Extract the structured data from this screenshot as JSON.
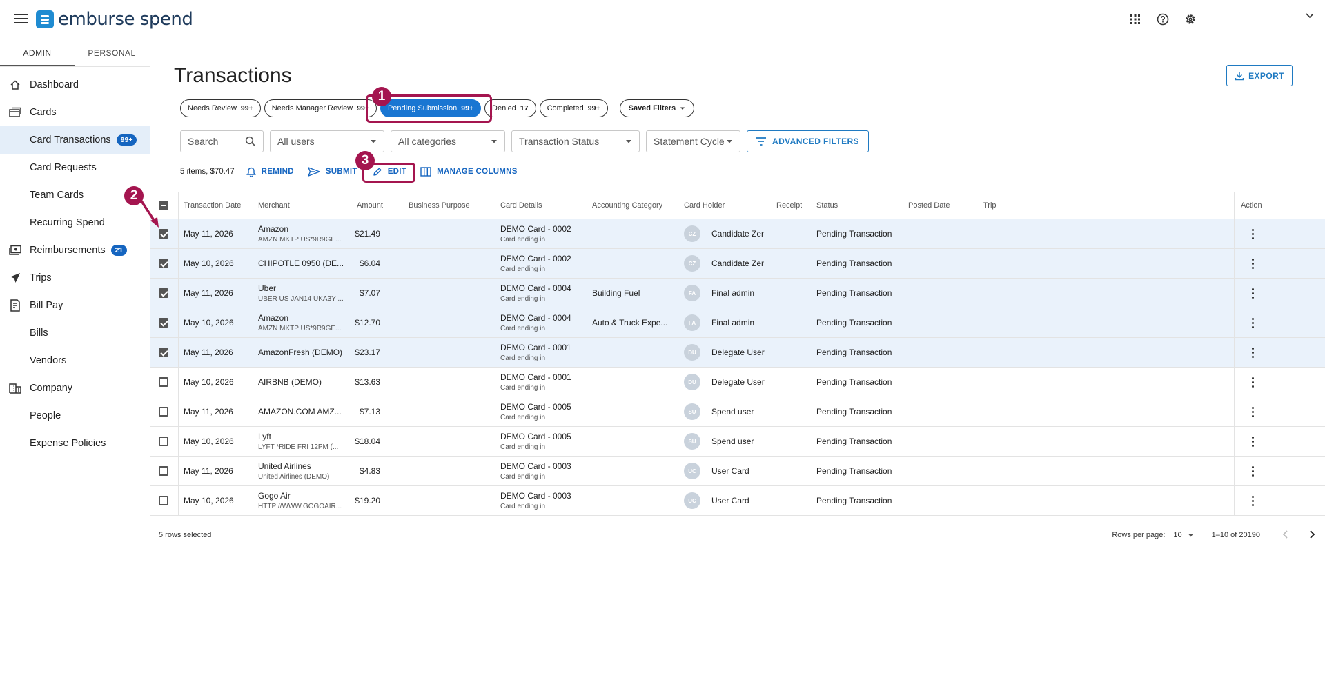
{
  "app": {
    "brand": "emburse spend"
  },
  "topbar": {
    "icons": [
      "apps-grid-icon",
      "help-icon",
      "settings-icon"
    ]
  },
  "sidebar": {
    "tabs": [
      {
        "label": "ADMIN"
      },
      {
        "label": "PERSONAL"
      }
    ],
    "items": [
      {
        "label": "Dashboard",
        "icon": "home-icon",
        "sub": false
      },
      {
        "label": "Cards",
        "icon": "cards-icon",
        "sub": false
      },
      {
        "label": "Card Transactions",
        "sub": true,
        "active": true,
        "badge": "99+"
      },
      {
        "label": "Card Requests",
        "sub": true
      },
      {
        "label": "Team Cards",
        "sub": true
      },
      {
        "label": "Recurring Spend",
        "sub": true
      },
      {
        "label": "Reimbursements",
        "icon": "money-icon",
        "sub": false,
        "badge": "21"
      },
      {
        "label": "Trips",
        "icon": "plane-icon",
        "sub": false
      },
      {
        "label": "Bill Pay",
        "icon": "bill-icon",
        "sub": false
      },
      {
        "label": "Bills",
        "sub": true
      },
      {
        "label": "Vendors",
        "sub": true
      },
      {
        "label": "Company",
        "icon": "building-icon",
        "sub": false
      },
      {
        "label": "People",
        "sub": true
      },
      {
        "label": "Expense Policies",
        "sub": true
      }
    ]
  },
  "main": {
    "title": "Transactions",
    "export_label": "EXPORT",
    "chips": [
      {
        "label": "Needs Review",
        "count": "99+"
      },
      {
        "label": "Needs Manager Review",
        "count": "99+"
      },
      {
        "label": "Pending Submission",
        "count": "99+",
        "active": true
      },
      {
        "label": "Denied",
        "count": "17"
      },
      {
        "label": "Completed",
        "count": "99+"
      }
    ],
    "saved_filters": "Saved Filters",
    "filters": {
      "search_placeholder": "Search",
      "users": "All users",
      "categories": "All categories",
      "status": "Transaction Status",
      "cycle": "Statement Cycle",
      "advanced": "ADVANCED FILTERS"
    },
    "summary": "5 items, $70.47",
    "actions": {
      "remind": "REMIND",
      "submit": "SUBMIT",
      "edit": "EDIT",
      "manage_columns": "MANAGE COLUMNS"
    },
    "markers": [
      "1",
      "2",
      "3"
    ]
  },
  "table": {
    "headers": {
      "date": "Transaction Date",
      "merchant": "Merchant",
      "amount": "Amount",
      "purpose": "Business Purpose",
      "card": "Card Details",
      "category": "Accounting Category",
      "holder": "Card Holder",
      "receipt": "Receipt",
      "status": "Status",
      "posted": "Posted Date",
      "trip": "Trip",
      "action": "Action"
    },
    "rows": [
      {
        "selected": true,
        "date": "May 11, 2026",
        "merchant": "Amazon",
        "merchant_sub": "AMZN MKTP US*9R9GE...",
        "amount": "$21.49",
        "card": "DEMO Card - 0002",
        "card_sub": "Card ending in",
        "category": "",
        "initials": "CZ",
        "holder": "Candidate Zer",
        "status": "Pending Transaction"
      },
      {
        "selected": true,
        "date": "May 10, 2026",
        "merchant": "CHIPOTLE 0950 (DE...",
        "merchant_sub": "",
        "amount": "$6.04",
        "card": "DEMO Card - 0002",
        "card_sub": "Card ending in",
        "category": "",
        "initials": "CZ",
        "holder": "Candidate Zer",
        "status": "Pending Transaction"
      },
      {
        "selected": true,
        "date": "May 11, 2026",
        "merchant": "Uber",
        "merchant_sub": "UBER US JAN14 UKA3Y ...",
        "amount": "$7.07",
        "card": "DEMO Card - 0004",
        "card_sub": "Card ending in",
        "category": "Building Fuel",
        "initials": "FA",
        "holder": "Final admin",
        "status": "Pending Transaction"
      },
      {
        "selected": true,
        "date": "May 10, 2026",
        "merchant": "Amazon",
        "merchant_sub": "AMZN MKTP US*9R9GE...",
        "amount": "$12.70",
        "card": "DEMO Card - 0004",
        "card_sub": "Card ending in",
        "category": "Auto & Truck Expe...",
        "initials": "FA",
        "holder": "Final admin",
        "status": "Pending Transaction"
      },
      {
        "selected": true,
        "date": "May 11, 2026",
        "merchant": "AmazonFresh (DEMO)",
        "merchant_sub": "",
        "amount": "$23.17",
        "card": "DEMO Card - 0001",
        "card_sub": "Card ending in",
        "category": "",
        "initials": "DU",
        "holder": "Delegate User",
        "status": "Pending Transaction"
      },
      {
        "selected": false,
        "date": "May 10, 2026",
        "merchant": "AIRBNB (DEMO)",
        "merchant_sub": "",
        "amount": "$13.63",
        "card": "DEMO Card - 0001",
        "card_sub": "Card ending in",
        "category": "",
        "initials": "DU",
        "holder": "Delegate User",
        "status": "Pending Transaction"
      },
      {
        "selected": false,
        "date": "May 11, 2026",
        "merchant": "AMAZON.COM AMZ...",
        "merchant_sub": "",
        "amount": "$7.13",
        "card": "DEMO Card - 0005",
        "card_sub": "Card ending in",
        "category": "",
        "initials": "SU",
        "holder": "Spend user",
        "status": "Pending Transaction"
      },
      {
        "selected": false,
        "date": "May 10, 2026",
        "merchant": "Lyft",
        "merchant_sub": "LYFT *RIDE FRI 12PM (...",
        "amount": "$18.04",
        "card": "DEMO Card - 0005",
        "card_sub": "Card ending in",
        "category": "",
        "initials": "SU",
        "holder": "Spend user",
        "status": "Pending Transaction"
      },
      {
        "selected": false,
        "date": "May 11, 2026",
        "merchant": "United Airlines",
        "merchant_sub": "United Airlines (DEMO)",
        "amount": "$4.83",
        "card": "DEMO Card - 0003",
        "card_sub": "Card ending in",
        "category": "",
        "initials": "UC",
        "holder": "User Card",
        "status": "Pending Transaction"
      },
      {
        "selected": false,
        "date": "May 10, 2026",
        "merchant": "Gogo Air",
        "merchant_sub": "HTTP://WWW.GOGOAIR...",
        "amount": "$19.20",
        "card": "DEMO Card - 0003",
        "card_sub": "Card ending in",
        "category": "",
        "initials": "UC",
        "holder": "User Card",
        "status": "Pending Transaction"
      }
    ]
  },
  "footer": {
    "selected_text": "5 rows selected",
    "rows_per_page_label": "Rows per page:",
    "rows_per_page": "10",
    "range": "1–10 of 20190"
  },
  "colors": {
    "accent": "#1976d2",
    "highlight": "#a4154f",
    "selected_row": "#eaf2fb"
  }
}
